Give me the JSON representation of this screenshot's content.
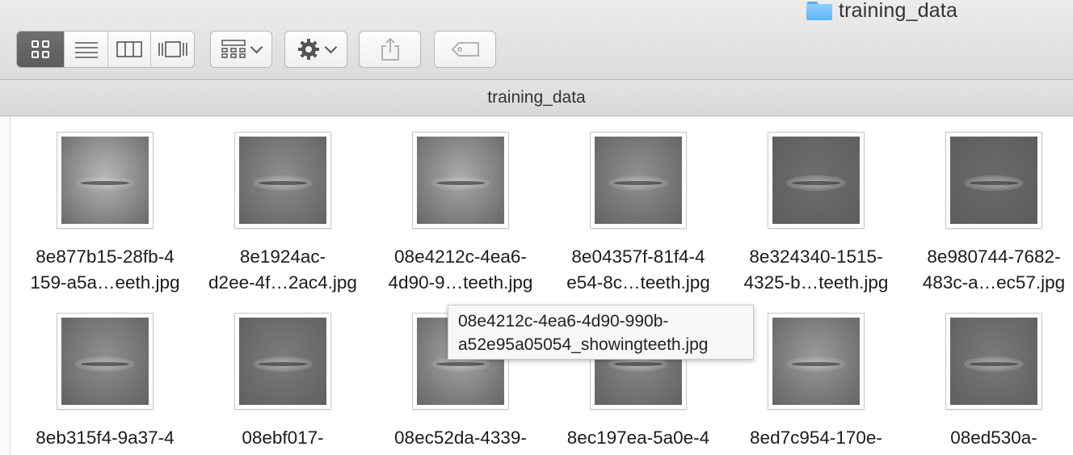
{
  "window": {
    "title": "training_data",
    "folder_icon": "folder-icon"
  },
  "toolbar": {
    "view_modes": [
      {
        "name": "icon-view",
        "icon": "icon-grid-icon",
        "active": true
      },
      {
        "name": "list-view",
        "icon": "list-icon",
        "active": false
      },
      {
        "name": "column-view",
        "icon": "columns-icon",
        "active": false
      },
      {
        "name": "gallery-view",
        "icon": "cover-flow-icon",
        "active": false
      }
    ],
    "arrange_icon": "arrange-icon",
    "action_icon": "gear-icon",
    "share_icon": "share-icon",
    "tag_icon": "tag-icon"
  },
  "path_bar": {
    "title": "training_data"
  },
  "files": [
    {
      "line1": "8e877b15-28fb-4",
      "line2": "159-a5a…eeth.jpg",
      "tone": "#b6b6b6"
    },
    {
      "line1": "8e1924ac-",
      "line2": "d2ee-4f…2ac4.jpg",
      "tone": "#8d8d8d"
    },
    {
      "line1": "08e4212c-4ea6-",
      "line2": "4d90-9…teeth.jpg",
      "tone": "#a9a9a9"
    },
    {
      "line1": "8e04357f-81f4-4",
      "line2": "e54-8c…teeth.jpg",
      "tone": "#909090"
    },
    {
      "line1": "8e324340-1515-",
      "line2": "4325-b…teeth.jpg",
      "tone": "#6e6e6e"
    },
    {
      "line1": "8e980744-7682-",
      "line2": "483c-a…ec57.jpg",
      "tone": "#6a6a6a"
    },
    {
      "line1": "8eb315f4-9a37-4",
      "line2": "",
      "tone": "#8f8f8f"
    },
    {
      "line1": "08ebf017-",
      "line2": "",
      "tone": "#7c7c7c"
    },
    {
      "line1": "08ec52da-4339-",
      "line2": "",
      "tone": "#a4a4a4"
    },
    {
      "line1": "8ec197ea-5a0e-4",
      "line2": "",
      "tone": "#8a8a8a"
    },
    {
      "line1": "8ed7c954-170e-",
      "line2": "",
      "tone": "#9a9a9a"
    },
    {
      "line1": "08ed530a-",
      "line2": "",
      "tone": "#7a7a7a"
    }
  ],
  "tooltip": {
    "line1": "08e4212c-4ea6-4d90-990b-",
    "line2": "a52e95a05054_showingteeth.jpg"
  }
}
